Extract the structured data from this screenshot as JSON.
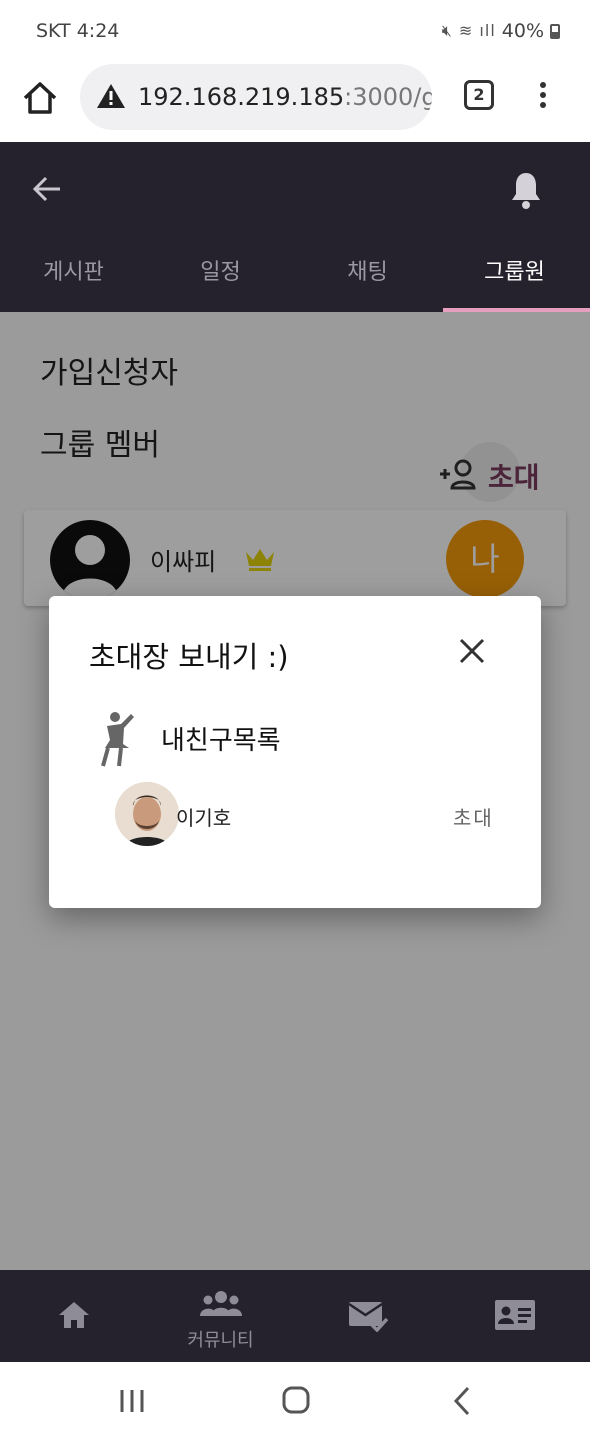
{
  "status_bar": {
    "carrier": "SKT",
    "time": "4:24",
    "battery": "40%"
  },
  "browser": {
    "url_host": "192.168.219.185",
    "url_rest": ":3000/g",
    "tab_count": "2"
  },
  "app": {
    "tabs": [
      {
        "label": "게시판",
        "active": false
      },
      {
        "label": "일정",
        "active": false
      },
      {
        "label": "채팅",
        "active": false
      },
      {
        "label": "그룹원",
        "active": true
      }
    ],
    "sections": {
      "applicants": "가입신청자",
      "members": "그룹 멤버"
    },
    "invite_label": "초대",
    "member": {
      "name": "이싸피",
      "me_badge": "나"
    }
  },
  "dialog": {
    "title": "초대장 보내기 :)",
    "friends_header": "내친구목록",
    "friends": [
      {
        "name": "이기호",
        "action": "초대"
      }
    ]
  },
  "bottom_nav": {
    "community_label": "커뮤니티"
  },
  "colors": {
    "header_bg": "#25222e",
    "tab_indicator": "#e79fc0",
    "invite_accent": "#7a3a5e",
    "me_badge": "#f59b0b",
    "crown": "#e2d40c"
  }
}
